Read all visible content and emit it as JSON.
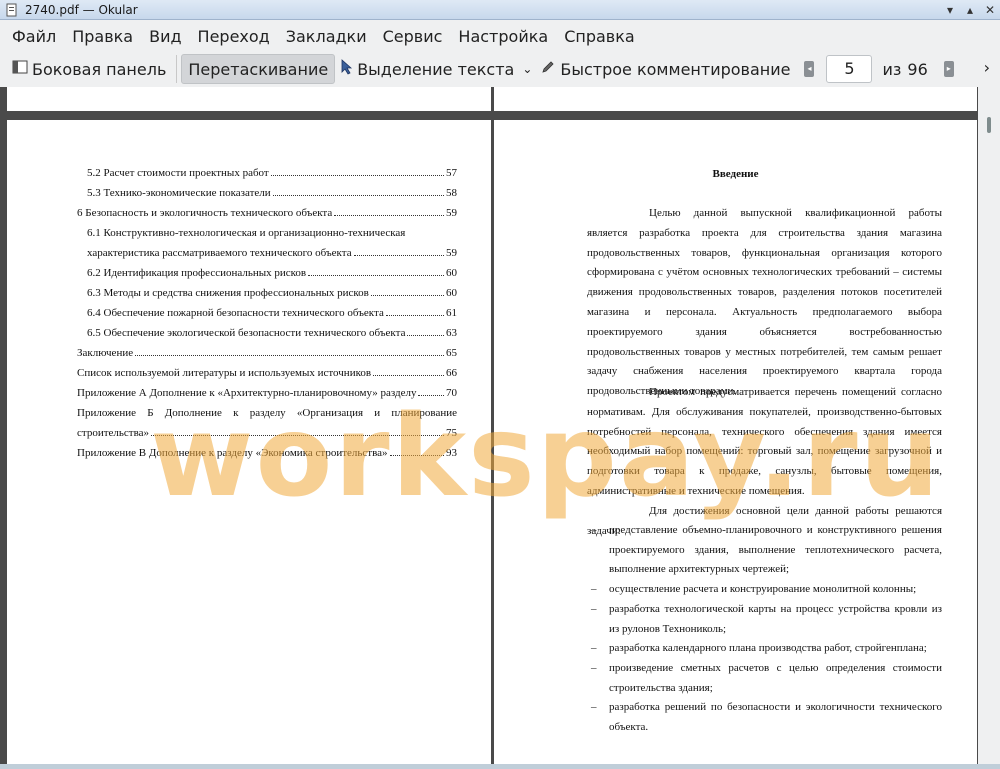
{
  "window": {
    "title": "2740.pdf — Okular"
  },
  "menu": [
    "Файл",
    "Правка",
    "Вид",
    "Переход",
    "Закладки",
    "Сервис",
    "Настройка",
    "Справка"
  ],
  "toolbar": {
    "sidebar_label": "Боковая панель",
    "drag_label": "Перетаскивание",
    "select_label": "Выделение текста",
    "comment_label": "Быстрое комментирование",
    "current_page": "5",
    "of_label": "из",
    "total_pages": "96"
  },
  "toc": [
    {
      "text": "5.2 Расчет стоимости проектных работ",
      "page": "57"
    },
    {
      "text": "5.3 Технико-экономические показатели",
      "page": "58"
    },
    {
      "text": "6 Безопасность и экологичность технического объекта",
      "page": "59"
    },
    {
      "text": "6.1 Конструктивно-технологическая и организационно-техническая"
    },
    {
      "text": "характеристика рассматриваемого технического объекта",
      "page": "59"
    },
    {
      "text": "6.2 Идентификация профессиональных рисков",
      "page": "60"
    },
    {
      "text": "6.3 Методы и средства снижения профессиональных рисков",
      "page": "60"
    },
    {
      "text": "6.4 Обеспечение пожарной безопасности технического объекта",
      "page": "61"
    },
    {
      "text": "6.5 Обеспечение экологической безопасности технического объекта",
      "page": "63"
    },
    {
      "text": "Заключение",
      "page": "65"
    },
    {
      "text": "Список используемой литературы и используемых источников",
      "page": "66"
    },
    {
      "text": "Приложение А Дополнение к «Архитектурно-планировочному» разделу",
      "page": "70"
    },
    {
      "text": "Приложение Б Дополнение к разделу «Организация и планирование"
    },
    {
      "text": "строительства»",
      "page": "75"
    },
    {
      "text": "Приложение В Дополнение к разделу «Экономика строительства»",
      "page": "93"
    }
  ],
  "intro": {
    "title": "Введение",
    "p1": "Целью данной выпускной квалификационной работы является разработка проекта для строительства здания магазина продовольственных товаров, функциональная организация которого сформирована с учётом основных технологических требований – системы движения продовольственных товаров, разделения потоков посетителей магазина и персонала. Актуальность предполагаемого выбора проектируемого здания объясняется востребованностью продовольственных товаров у местных потребителей, тем самым решает задачу снабжения населения проектируемого квартала города продовольственными товарами.",
    "p2": "Проектом предусматривается перечень помещений согласно нормативам. Для обслуживания покупателей, производственно-бытовых потребностей персонала, технического обеспечения здания имеется необходимый набор помещений: торговый зал, помещение загрузочной и подготовки товара к продаже, санузлы, бытовые помещения, административные и технические помещения.",
    "p3": "Для достижения основной цели данной работы решаются задачи:",
    "bullets": [
      "представление объемно-планировочного и конструктивного решения проектируемого здания, выполнение теплотехнического расчета, выполнение архитектурных чертежей;",
      "осуществление расчета и конструирование монолитной колонны;",
      "разработка технологической карты на процесс устройства кровли из из рулонов Технониколь;",
      "разработка календарного плана производства работ, стройгенплана;",
      "произведение сметных расчетов с целью определения стоимости строительства здания;",
      "разработка решений по безопасности и экологичности технического объекта."
    ],
    "dash": "–"
  },
  "watermark": "workspay.ru",
  "colors": {
    "accent": "#d3d5d8",
    "doc_bg": "#4a4a4a",
    "watermark": "#f0aa3c"
  }
}
